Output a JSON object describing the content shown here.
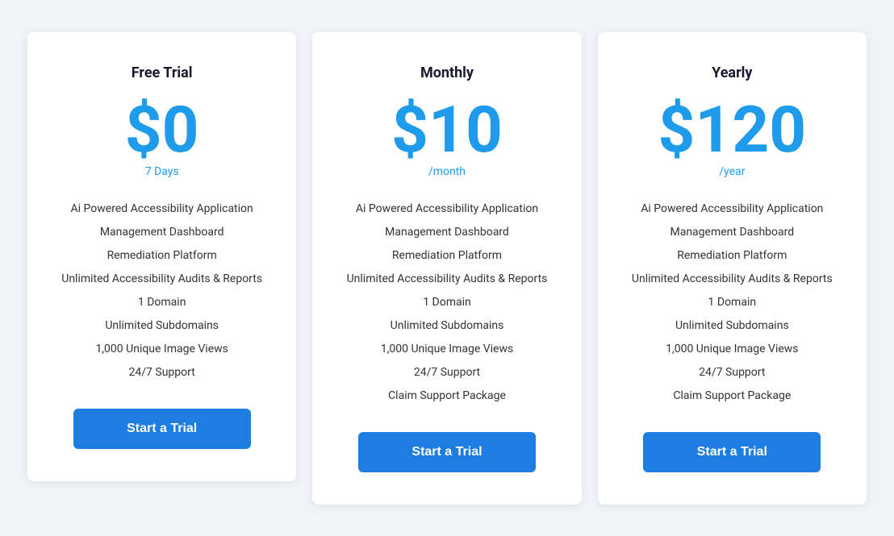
{
  "plans": [
    {
      "id": "free",
      "title": "Free Trial",
      "price": "$0",
      "period": "7 Days",
      "features": [
        "Ai Powered Accessibility Application",
        "Management Dashboard",
        "Remediation Platform",
        "Unlimited Accessibility Audits & Reports",
        "1 Domain",
        "Unlimited Subdomains",
        "1,000 Unique Image Views",
        "24/7 Support"
      ],
      "cta": "Start a Trial"
    },
    {
      "id": "monthly",
      "title": "Monthly",
      "price": "$10",
      "period": "/month",
      "features": [
        "Ai Powered Accessibility Application",
        "Management Dashboard",
        "Remediation Platform",
        "Unlimited Accessibility Audits & Reports",
        "1 Domain",
        "Unlimited Subdomains",
        "1,000 Unique Image Views",
        "24/7 Support",
        "Claim Support Package"
      ],
      "cta": "Start a Trial"
    },
    {
      "id": "yearly",
      "title": "Yearly",
      "price": "$120",
      "period": "/year",
      "features": [
        "Ai Powered Accessibility Application",
        "Management Dashboard",
        "Remediation Platform",
        "Unlimited Accessibility Audits & Reports",
        "1 Domain",
        "Unlimited Subdomains",
        "1,000 Unique Image Views",
        "24/7 Support",
        "Claim Support Package"
      ],
      "cta": "Start a Trial"
    }
  ]
}
